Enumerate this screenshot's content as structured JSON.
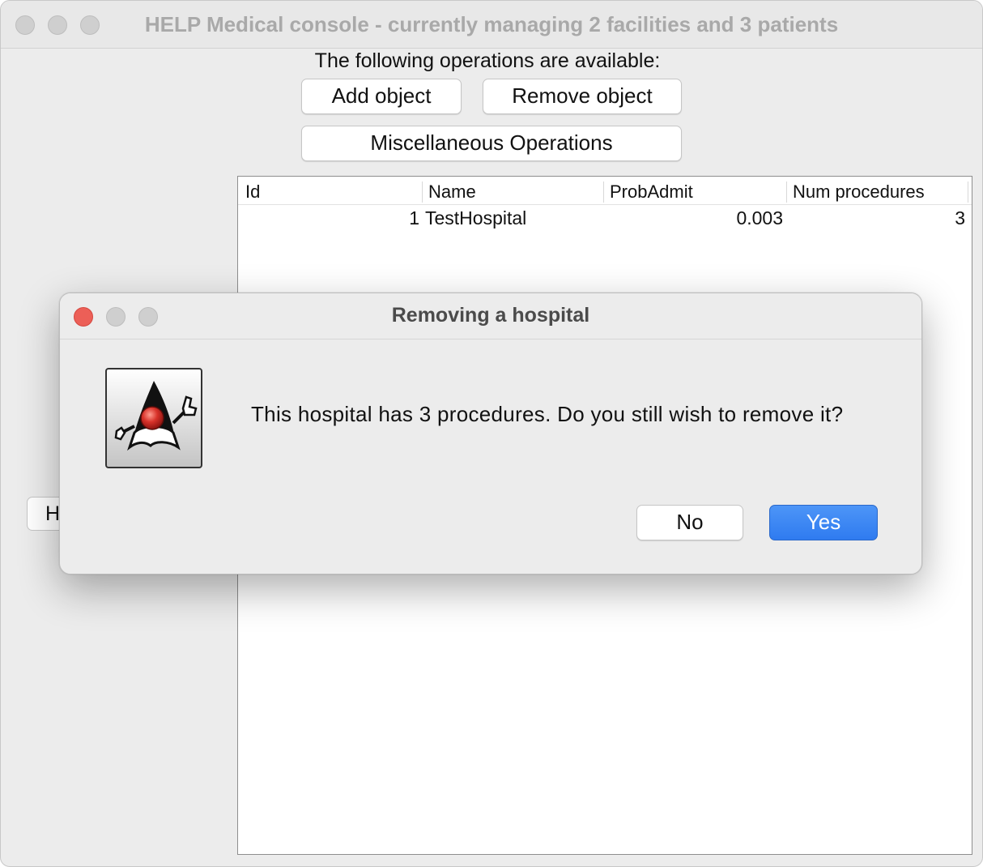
{
  "window": {
    "title": "HELP Medical console - currently managing 2 facilities and 3 patients"
  },
  "operations": {
    "label": "The following operations are available:",
    "add_label": "Add object",
    "remove_label": "Remove object",
    "misc_label": "Miscellaneous Operations"
  },
  "table": {
    "columns": [
      "Id",
      "Name",
      "ProbAdmit",
      "Num procedures"
    ],
    "rows": [
      {
        "id": "1",
        "name": "TestHospital",
        "prob_admit": "0.003",
        "num_procedures": "3"
      }
    ]
  },
  "side_button": {
    "label": "H"
  },
  "dialog": {
    "title": "Removing a hospital",
    "message": "This hospital has 3 procedures. Do you still wish to remove it?",
    "no_label": "No",
    "yes_label": "Yes",
    "icon": "java-duke-icon"
  },
  "colors": {
    "accent": "#3a83f4",
    "close": "#ec5f57",
    "inactive_traffic": "#cfcfcf"
  }
}
